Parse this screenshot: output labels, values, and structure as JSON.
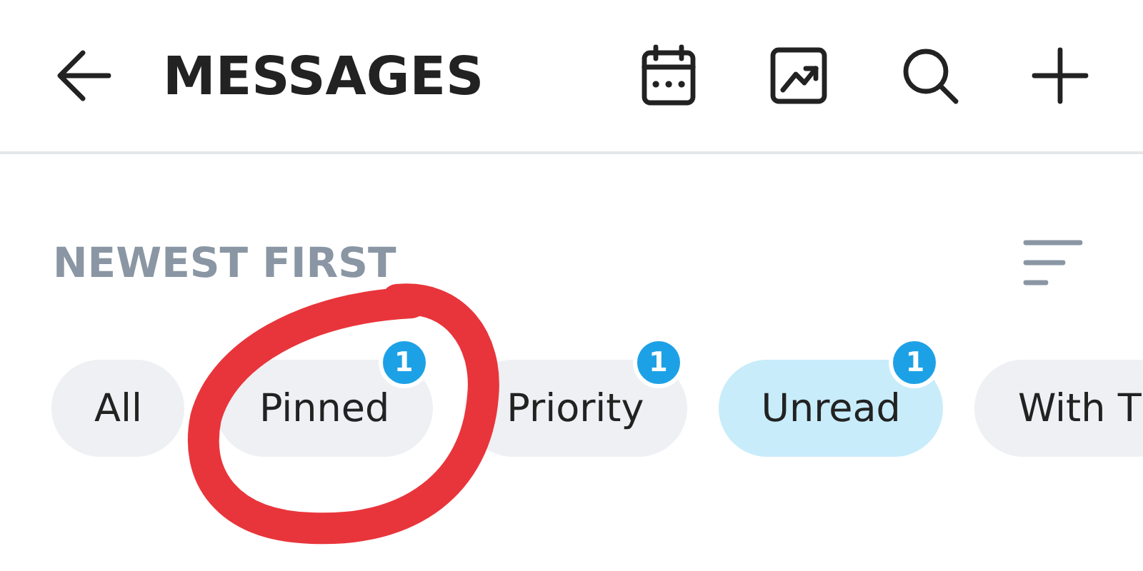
{
  "header": {
    "title": "MESSAGES"
  },
  "sort": {
    "label": "NEWEST FIRST"
  },
  "filters": [
    {
      "label": "All",
      "selected": false
    },
    {
      "label": "Pinned",
      "selected": false,
      "badge": "1"
    },
    {
      "label": "Priority",
      "selected": false,
      "badge": "1"
    },
    {
      "label": "Unread",
      "selected": true,
      "badge": "1"
    },
    {
      "label": "With T",
      "selected": false
    }
  ],
  "annotation": {
    "kind": "circle",
    "color": "#e8353b"
  }
}
